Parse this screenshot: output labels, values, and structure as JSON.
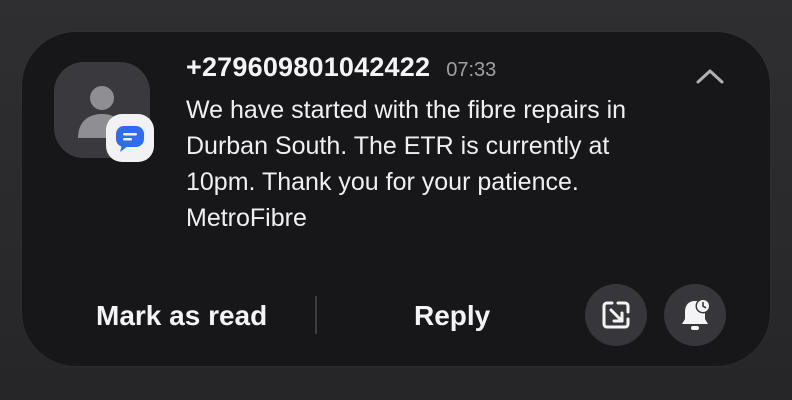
{
  "notification": {
    "sender": "+279609801042422",
    "time": "07:33",
    "message": "We have started with the fibre repairs in Durban South. The ETR is currently at 10pm. Thank you for your patience. MetroFibre",
    "app_icon": "messages-app-icon",
    "avatar_icon": "contact-person-icon",
    "collapse_icon": "chevron-up-icon"
  },
  "actions": {
    "mark_as_read": "Mark as read",
    "reply": "Reply",
    "open_icon": "open-in-app-icon",
    "snooze_icon": "notification-bell-snooze-icon"
  },
  "colors": {
    "card_background": "#171719",
    "app_accent": "#2f6cf0",
    "text_primary": "#f4f4f6",
    "text_secondary": "#a0a0a4"
  }
}
